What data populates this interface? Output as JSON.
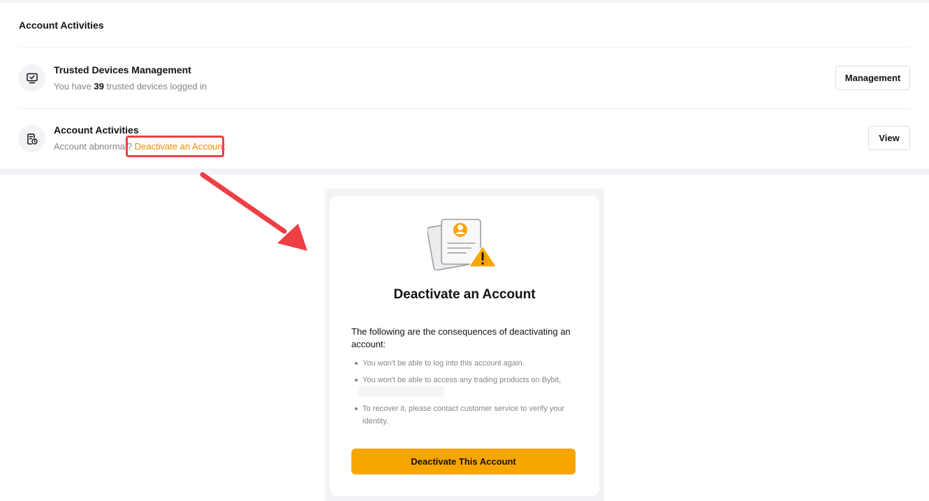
{
  "section": {
    "title": "Account Activities"
  },
  "trusted_devices": {
    "icon": "monitor-check-icon",
    "title": "Trusted Devices Management",
    "sub_prefix": "You have",
    "count": "39",
    "sub_suffix": "trusted devices logged in",
    "button_label": "Management"
  },
  "account_activities": {
    "icon": "document-clock-icon",
    "title": "Account Activities",
    "sub_prefix": "Account abnormal?",
    "link_label": "Deactivate an Account",
    "button_label": "View"
  },
  "modal": {
    "illustration": "document-warning-illustration",
    "title": "Deactivate an Account",
    "intro": "The following are the consequences of deactivating an account:",
    "bullets": [
      "You won't be able to log into this account again.",
      "You won't be able to access any trading products on Bybit,",
      "To recover it, please contact customer service to verify your identity."
    ],
    "button_label": "Deactivate This Account"
  },
  "colors": {
    "accent": "#F7A600",
    "link": "#E88B00",
    "annotation": "#EE3F44"
  }
}
